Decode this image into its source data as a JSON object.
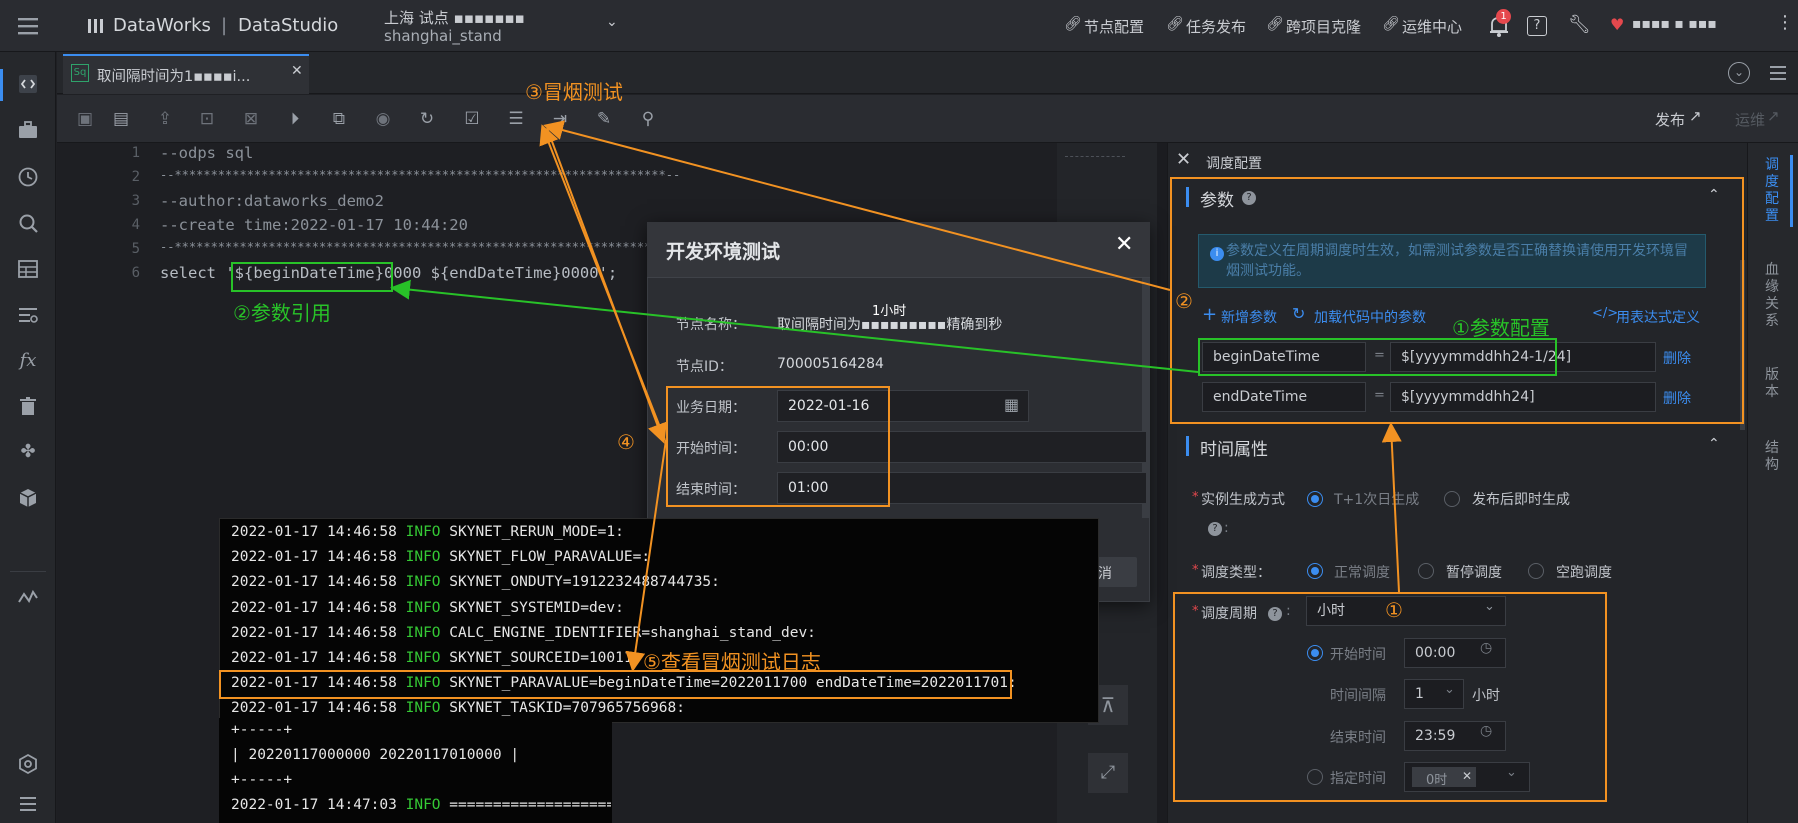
{
  "topbar": {
    "brand": "DataWorks",
    "separator": "|",
    "app": "DataStudio",
    "workspace": "上海 试点 ▪▪▪▪▪▪▪",
    "region": "shanghai_stand",
    "links": [
      "节点配置",
      "任务发布",
      "跨项目克隆",
      "运维中心"
    ],
    "notify_count": "1",
    "user": "▪▪▪▪ ▪ ▪▪▪"
  },
  "tab": {
    "icon_text": "Sq",
    "label": "取间隔时间为1▪▪▪▪i..."
  },
  "toolbar": {
    "publish": "发布",
    "ops": "运维"
  },
  "editor": {
    "line_numbers": [
      "1",
      "2",
      "3",
      "4",
      "5",
      "6"
    ],
    "lines": [
      "--odps sql",
      "--********************************************************************--",
      "--author:dataworks_demo2",
      "--create time:2022-01-17 10:44:20",
      "--********************************************************************--",
      "select '${beginDateTime}0000 ${endDateTime}0000';"
    ]
  },
  "panel": {
    "title": "调度配置",
    "params_title": "参数",
    "params_info": "参数定义在周期调度时生效，如需测试参数是否正确替换请使用开发环境冒烟测试功能。",
    "add_param": "新增参数",
    "load_params": "加载代码中的参数",
    "expr_define": "用表达式定义",
    "params": [
      {
        "name": "beginDateTime",
        "eq": "=",
        "value": "$[yyyymmddhh24-1/24]",
        "delete": "删除"
      },
      {
        "name": "endDateTime",
        "eq": "=",
        "value": "$[yyyymmddhh24]",
        "delete": "删除"
      }
    ],
    "time_title": "时间属性",
    "instance_label": "实例生成方式",
    "instance_opt1": "T+1次日生成",
    "instance_opt2": "发布后即时生成",
    "sched_type_label": "调度类型：",
    "sched_types": [
      "正常调度",
      "暂停调度",
      "空跑调度"
    ],
    "period_label": "调度周期",
    "period_value": "小时",
    "start_label": "开始时间",
    "start_value": "00:00",
    "interval_label": "时间间隔",
    "interval_value": "1",
    "interval_unit": "小时",
    "end_label": "结束时间",
    "end_value": "23:59",
    "specify_label": "指定时间",
    "specify_tag": "0时"
  },
  "right_strip": [
    "调度配置",
    "血缘关系",
    "版本",
    "结构"
  ],
  "dialog": {
    "title": "开发环境测试",
    "close": "✕",
    "node_name_label": "节点名称：",
    "node_name_value": "取间隔时间为▪▪▪▪▪▪▪▪▪精确到秒",
    "node_name_tip": "1小时",
    "node_id_label": "节点ID：",
    "node_id_value": "700005164284",
    "biz_date_label": "业务日期：",
    "biz_date_value": "2022-01-16",
    "start_label": "开始时间：",
    "start_value": "00:00",
    "end_label": "结束时间：",
    "end_value": "01:00",
    "cancel": "消"
  },
  "log": {
    "lines": [
      {
        "ts": "2022-01-17 14:46:58",
        "lvl": "INFO",
        "msg": "SKYNET_RERUN_MODE=1:"
      },
      {
        "ts": "2022-01-17 14:46:58",
        "lvl": "INFO",
        "msg": "SKYNET_FLOW_PARAVALUE=:"
      },
      {
        "ts": "2022-01-17 14:46:58",
        "lvl": "INFO",
        "msg": "SKYNET_ONDUTY=1912232488744735:"
      },
      {
        "ts": "2022-01-17 14:46:58",
        "lvl": "INFO",
        "msg": "SKYNET_SYSTEMID=dev:"
      },
      {
        "ts": "2022-01-17 14:46:58",
        "lvl": "INFO",
        "msg": "CALC_ENGINE_IDENTIFIER=shanghai_stand_dev:"
      },
      {
        "ts": "2022-01-17 14:46:58",
        "lvl": "INFO",
        "msg": "SKYNET_SOURCEID=10011:"
      },
      {
        "ts": "2022-01-17 14:46:58",
        "lvl": "INFO",
        "msg": "SKYNET_PARAVALUE=beginDateTime=2022011700 endDateTime=2022011701:"
      },
      {
        "ts": "2022-01-17 14:46:58",
        "lvl": "INFO",
        "msg": "SKYNET_TASKID=707965756968:"
      }
    ],
    "table_border": "+-----+",
    "table_row": "| 20220117000000 20220117010000 |",
    "last_ts": "2022-01-17 14:47:03",
    "last_lvl": "INFO",
    "last_msg": "=========================="
  },
  "annotations": {
    "smoke_test": "③冒烟测试",
    "param_ref": "②参数引用",
    "param_config": "①参数配置",
    "mark2": "②",
    "mark4": "④",
    "mark1": "①",
    "view_log": "⑤查看冒烟测试日志"
  },
  "colors": {
    "accent": "#3b8df0",
    "annotation_orange": "#f29222",
    "annotation_green": "#28c228",
    "log_info": "#35c935"
  }
}
